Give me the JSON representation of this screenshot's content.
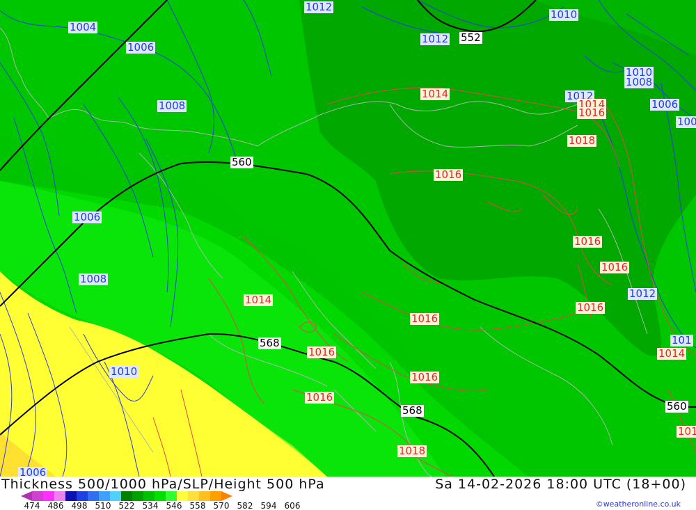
{
  "title": "Thickness 500/1000 hPa/SLP/Height 500 hPa",
  "datetime": "Sa 14-02-2026 18:00 UTC (18+00)",
  "credit": "©weatheronline.co.uk",
  "legend": {
    "colors": [
      "#b030b0",
      "#d040d0",
      "#ff30ff",
      "#f080f0",
      "#1010b0",
      "#2040e0",
      "#3070f0",
      "#40a0ff",
      "#50d0ff",
      "#008000",
      "#00a000",
      "#00c000",
      "#00e000",
      "#30ff30",
      "#ffff40",
      "#ffe040",
      "#ffc020",
      "#ffa000",
      "#ff8000"
    ],
    "ticks": [
      "474",
      "486",
      "498",
      "510",
      "522",
      "534",
      "546",
      "558",
      "570",
      "582",
      "594",
      "606"
    ]
  },
  "isobar_labels": [
    {
      "text": "1004",
      "color": "blue"
    },
    {
      "text": "1006",
      "color": "blue"
    },
    {
      "text": "1008",
      "color": "blue"
    },
    {
      "text": "1012",
      "color": "blue"
    },
    {
      "text": "1012",
      "color": "blue"
    },
    {
      "text": "1010",
      "color": "blue"
    },
    {
      "text": "1010",
      "color": "blue"
    },
    {
      "text": "1008",
      "color": "blue"
    },
    {
      "text": "1012",
      "color": "blue"
    },
    {
      "text": "1006",
      "color": "blue"
    },
    {
      "text": "100",
      "color": "blue"
    },
    {
      "text": "1006",
      "color": "blue"
    },
    {
      "text": "1008",
      "color": "blue"
    },
    {
      "text": "1010",
      "color": "blue"
    },
    {
      "text": "1006",
      "color": "blue"
    },
    {
      "text": "1012",
      "color": "blue"
    },
    {
      "text": "101",
      "color": "blue"
    },
    {
      "text": "1014",
      "color": "red"
    },
    {
      "text": "1014",
      "color": "red"
    },
    {
      "text": "1016",
      "color": "red"
    },
    {
      "text": "1018",
      "color": "red"
    },
    {
      "text": "1016",
      "color": "red"
    },
    {
      "text": "1016",
      "color": "red"
    },
    {
      "text": "1016",
      "color": "red"
    },
    {
      "text": "1016",
      "color": "red"
    },
    {
      "text": "1014",
      "color": "red"
    },
    {
      "text": "1016",
      "color": "red"
    },
    {
      "text": "1016",
      "color": "red"
    },
    {
      "text": "1016",
      "color": "red"
    },
    {
      "text": "1016",
      "color": "red"
    },
    {
      "text": "1018",
      "color": "red"
    },
    {
      "text": "1014",
      "color": "red"
    },
    {
      "text": "101",
      "color": "red"
    }
  ],
  "height_labels": [
    "552",
    "560",
    "568",
    "568",
    "560"
  ]
}
